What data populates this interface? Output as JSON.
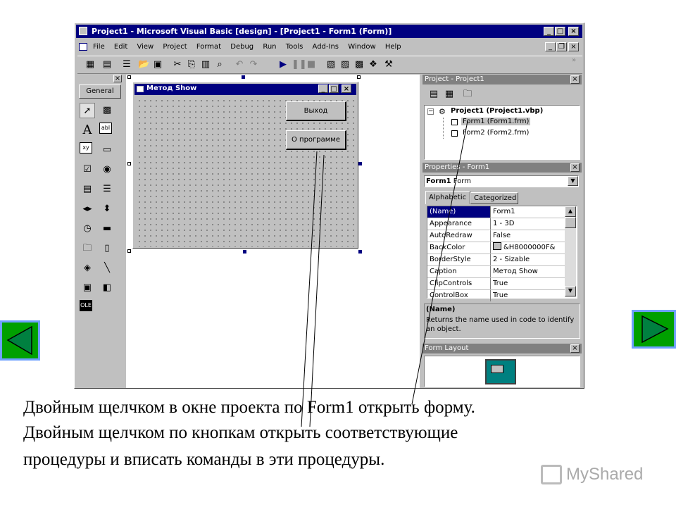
{
  "window": {
    "title": "Project1 - Microsoft Visual Basic [design] - [Project1 - Form1 (Form)]"
  },
  "menu": [
    "File",
    "Edit",
    "View",
    "Project",
    "Format",
    "Debug",
    "Run",
    "Tools",
    "Add-Ins",
    "Window",
    "Help"
  ],
  "toolbox": {
    "tab_label": "General",
    "tools": [
      "pointer-icon",
      "picturebox-icon",
      "label-icon",
      "textbox-icon",
      "frame-icon",
      "commandbutton-icon",
      "checkbox-icon",
      "optionbutton-icon",
      "combobox-icon",
      "listbox-icon",
      "hscrollbar-icon",
      "vscrollbar-icon",
      "timer-icon",
      "drivelistbox-icon",
      "dirlistbox-icon",
      "filelistbox-icon",
      "shape-icon",
      "line-icon",
      "image-icon",
      "data-icon",
      "ole-icon"
    ],
    "textbox_glyph": "abl",
    "frame_glyph": "xy",
    "ole_glyph": "OLE",
    "label_glyph": "A"
  },
  "form": {
    "title": "Метод Show",
    "buttons": [
      "Выход",
      "О программе"
    ]
  },
  "project_panel": {
    "title": "Project - Project1",
    "tree": {
      "root": "Project1 (Project1.vbp)",
      "children": [
        "Form1 (Form1.frm)",
        "Form2 (Form2.frm)"
      ]
    }
  },
  "properties_panel": {
    "title": "Properties - Form1",
    "object_name": "Form1",
    "object_type": "Form",
    "tabs": [
      "Alphabetic",
      "Categorized"
    ],
    "rows": [
      {
        "k": "(Name)",
        "v": "Form1"
      },
      {
        "k": "Appearance",
        "v": "1 - 3D"
      },
      {
        "k": "AutoRedraw",
        "v": "False"
      },
      {
        "k": "BackColor",
        "v": "&H8000000F&"
      },
      {
        "k": "BorderStyle",
        "v": "2 - Sizable"
      },
      {
        "k": "Caption",
        "v": "Метод Show"
      },
      {
        "k": "ClipControls",
        "v": "True"
      },
      {
        "k": "ControlBox",
        "v": "True"
      }
    ],
    "desc_title": "(Name)",
    "desc_text": "Returns the name used in code to identify an object."
  },
  "form_layout": {
    "title": "Form Layout"
  },
  "caption_lines": [
    "Двойным щелчком в окне проекта по Form1 открыть форму.",
    "Двойным щелчком по кнопкам открыть соответствующие",
    "процедуры и вписать команды в эти процедуры."
  ],
  "logo": "MyShared",
  "colors": {
    "title_active": "#000080",
    "nav_button": "#00a000",
    "nav_border": "#6fa0ff"
  }
}
